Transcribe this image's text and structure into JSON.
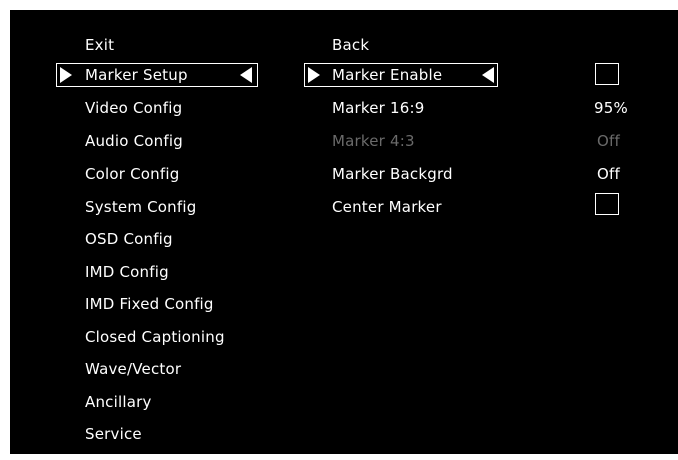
{
  "colors": {
    "background": "#000000",
    "text": "#ffffff",
    "disabled_text": "#6a6a6a"
  },
  "main_menu": {
    "items": [
      {
        "label": "Exit"
      },
      {
        "label": "Marker Setup",
        "selected": true
      },
      {
        "label": "Video Config"
      },
      {
        "label": "Audio Config"
      },
      {
        "label": "Color Config"
      },
      {
        "label": "System Config"
      },
      {
        "label": "OSD Config"
      },
      {
        "label": "IMD Config"
      },
      {
        "label": "IMD Fixed Config"
      },
      {
        "label": "Closed Captioning"
      },
      {
        "label": "Wave/Vector"
      },
      {
        "label": "Ancillary"
      },
      {
        "label": "Service"
      }
    ]
  },
  "sub_menu": {
    "items": [
      {
        "label": "Back"
      },
      {
        "label": "Marker Enable",
        "selected": true,
        "control": "checkbox",
        "checked": false
      },
      {
        "label": "Marker 16:9",
        "value": "95%"
      },
      {
        "label": "Marker 4:3",
        "value": "Off",
        "disabled": true
      },
      {
        "label": "Marker Backgrd",
        "value": "Off"
      },
      {
        "label": "Center Marker",
        "control": "checkbox",
        "checked": false
      }
    ]
  },
  "icons": {
    "selection_left": "triangle-right-icon",
    "selection_right": "triangle-left-icon"
  }
}
